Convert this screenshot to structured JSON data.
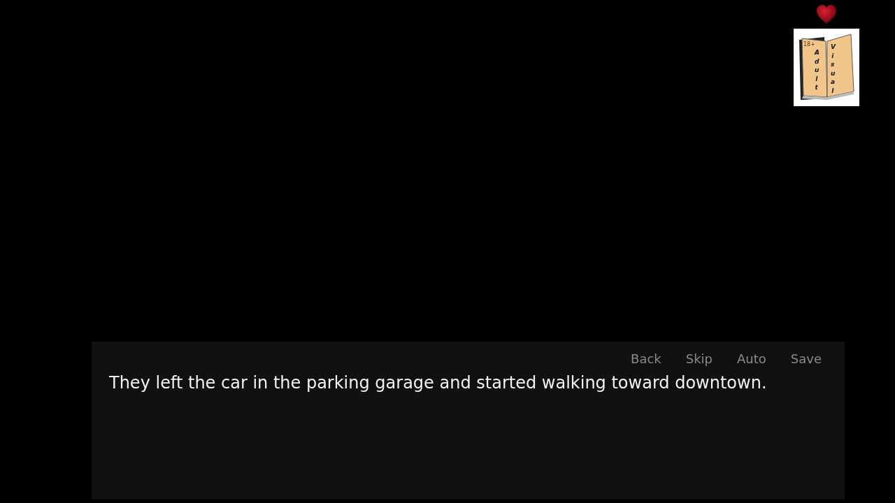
{
  "logo": {
    "badge": "18+",
    "left_word": "Adult",
    "right_word": "Visual"
  },
  "quick_menu": [
    "Back",
    "Skip",
    "Auto",
    "Save"
  ],
  "dialogue": {
    "text": "They left the car in the parking garage and started walking toward downtown."
  }
}
